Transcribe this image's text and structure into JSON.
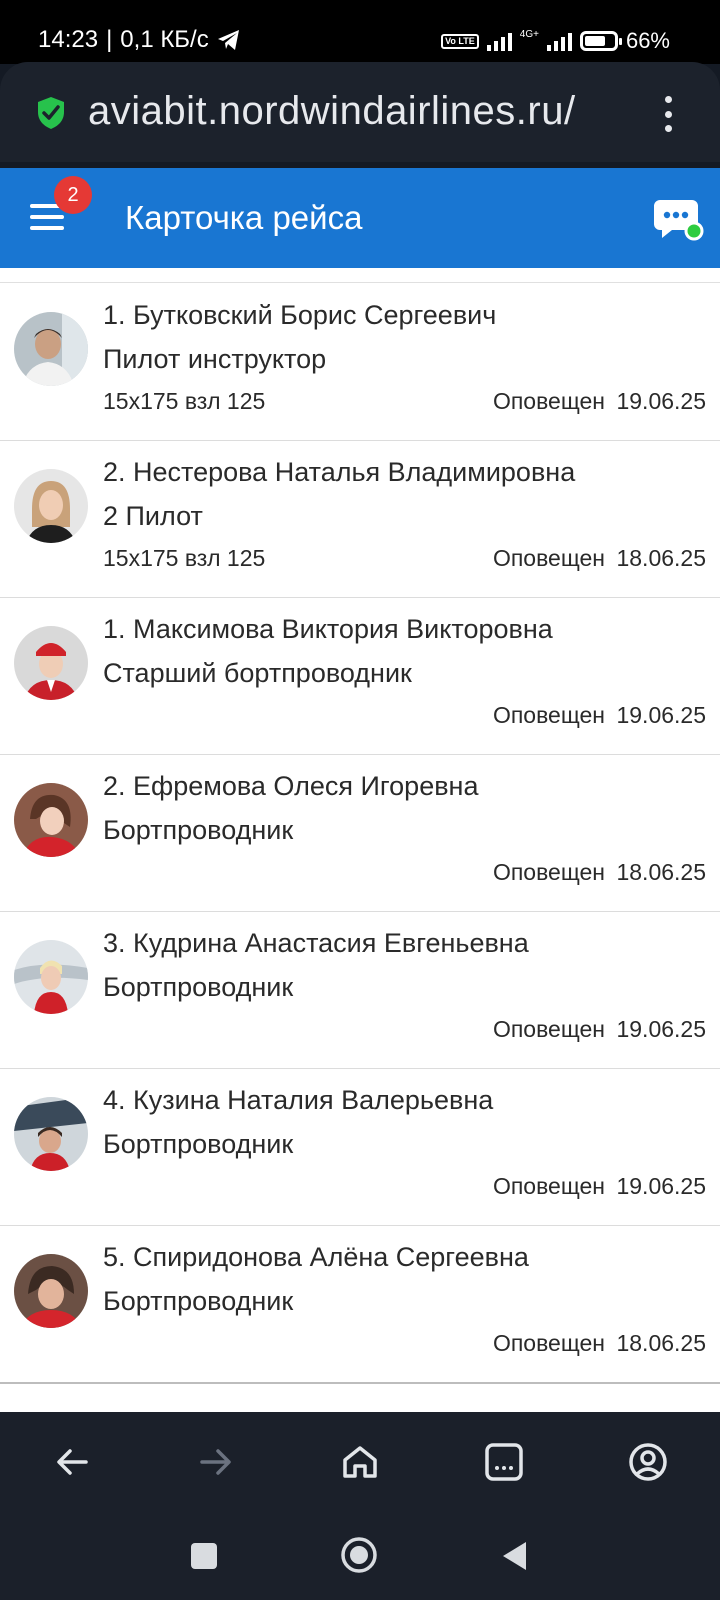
{
  "status_bar": {
    "time": "14:23",
    "separator": "|",
    "net_speed": "0,1 КБ/с",
    "volte": "Vo LTE",
    "network": "4G+",
    "battery": "66%"
  },
  "browser": {
    "url": "aviabit.nordwindairlines.ru/"
  },
  "app_header": {
    "title": "Карточка рейса",
    "menu_badge": "2"
  },
  "crew": [
    {
      "name": "1. Бутковский Борис Сергеевич",
      "role": "Пилот инструктор",
      "seat": "15x175 взл 125",
      "status": "Оповещен",
      "date": "19.06.25"
    },
    {
      "name": "2. Нестерова Наталья Владимировна",
      "role": "2 Пилот",
      "seat": "15x175 взл 125",
      "status": "Оповещен",
      "date": "18.06.25"
    },
    {
      "name": "1. Максимова Виктория Викторовна",
      "role": "Старший бортпроводник",
      "seat": "",
      "status": "Оповещен",
      "date": "19.06.25"
    },
    {
      "name": "2. Ефремова Олеся Игоревна",
      "role": "Бортпроводник",
      "seat": "",
      "status": "Оповещен",
      "date": "18.06.25"
    },
    {
      "name": "3. Кудрина Анастасия Евгеньевна",
      "role": "Бортпроводник",
      "seat": "",
      "status": "Оповещен",
      "date": "19.06.25"
    },
    {
      "name": "4. Кузина Наталия Валерьевна",
      "role": "Бортпроводник",
      "seat": "",
      "status": "Оповещен",
      "date": "19.06.25"
    },
    {
      "name": "5. Спиридонова Алёна Сергеевна",
      "role": "Бортпроводник",
      "seat": "",
      "status": "Оповещен",
      "date": "18.06.25"
    }
  ],
  "bottom_nav": {
    "icons": [
      "back-arrow-icon",
      "forward-arrow-icon",
      "home-icon",
      "tabs-icon",
      "account-icon"
    ]
  },
  "system_nav": {
    "icons": [
      "recents-square-icon",
      "home-circle-icon",
      "back-triangle-icon"
    ]
  },
  "colors": {
    "header_blue": "#1976d2",
    "badge_red": "#e53935",
    "online_green": "#2ecc40",
    "secure_green": "#27c24c"
  }
}
